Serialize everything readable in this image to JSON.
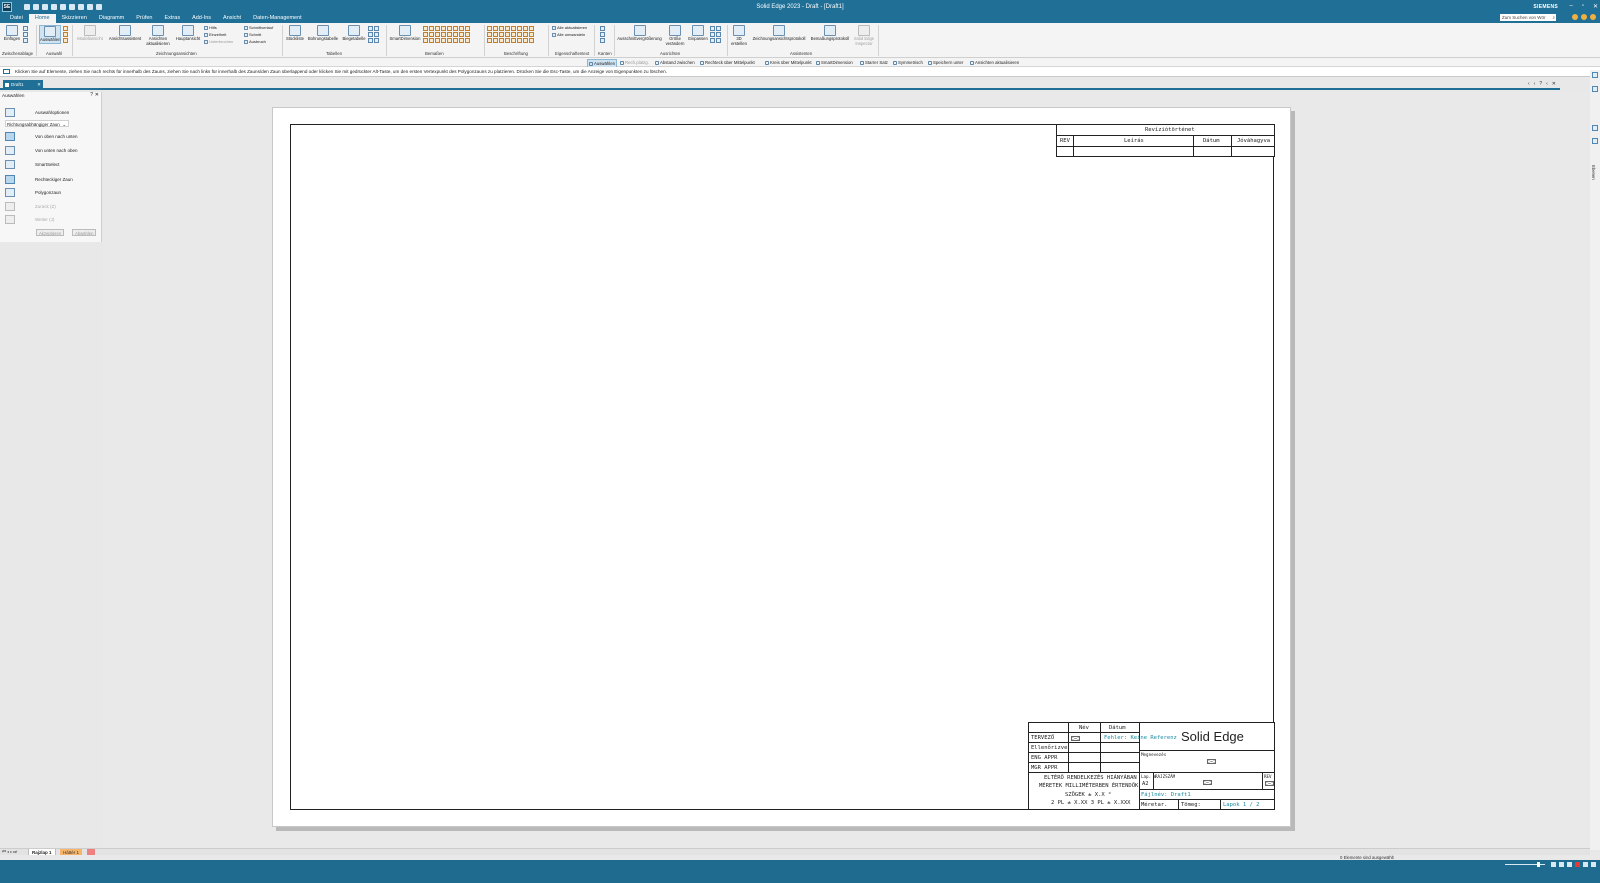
{
  "titlebar": {
    "title": "Solid Edge 2023 - Draft - [Draft1]",
    "brand": "SIEMENS",
    "min": "–",
    "restore": "▫",
    "close": "✕"
  },
  "menu": {
    "tabs": [
      "Datei",
      "Home",
      "Skizzieren",
      "Diagramm",
      "Prüfen",
      "Extras",
      "Add-Ins",
      "Ansicht",
      "Daten-Management"
    ],
    "active": "Home",
    "search_placeholder": "Zum Suchen von Wör",
    "search_icon": "⌕"
  },
  "ribbon": {
    "einfuegen": "Einfügen",
    "auswaehlen": "Auswählen",
    "modellansicht": "Modellansicht",
    "ansichtsassistent": "Ansichtsassistent",
    "ansichten_aktualisieren": "Ansichten aktualisieren",
    "hauptansicht": "Hauptansicht",
    "hilfs": "Hilfs",
    "einzelheit": "Einzelheit",
    "unterbrochen": "Unterbrochen",
    "schnittverlauf": "Schnittverlauf",
    "schnitt": "Schnitt",
    "ausbruch": "Ausbruch",
    "stueckliste": "Stückliste",
    "bohrungstabelle": "Bohrungstabelle",
    "biegetabelle": "Biegetabelle",
    "smartdimension": "SmartDimension",
    "alle_aktualisieren": "Alle aktualisieren",
    "alle_umwandeln": "Alle umwandeln",
    "ausschnittvergroesserung": "Ausschnittvergrößerung",
    "groesse_veraendern": "Größe verändern",
    "einpassen": "Einpassen",
    "erstellen_3d": "3D erstellen",
    "zeichnungsansichtsprotokoll": "Zeichnungsansichtsprotokoll",
    "bemassungsprotokoll": "Bemaßungsprotokoll",
    "solid_edge_inspector": "Solid Edge Inspector",
    "groups": {
      "zwischenablage": "Zwischenablage",
      "auswahl": "Auswahl",
      "zeichnungsansichten": "Zeichnungsansichten",
      "tabellen": "Tabellen",
      "bemassen": "Bemaßen",
      "beschriftung": "Beschriftung",
      "eigenschaftentext": "Eigenschaftentext",
      "kanten": "Kanten",
      "ausrichten": "Ausrichten",
      "assistenten": "Assistenten"
    }
  },
  "cmdbar": {
    "auswaehlen": "Auswählen",
    "rechpunkt": "Rech.platzg.",
    "abstand": "Abstand zwischen",
    "rechteck": "Rechteck über Mittelpunkt",
    "kreis": "Kreis über Mittelpunkt",
    "smartdimension": "SmartDimension",
    "starrer_satz": "Starrer Satz",
    "symmetrisch": "Symmetrisch",
    "speichern_unter": "Speichern unter",
    "ansichten_aktualisieren": "Ansichten aktualisieren"
  },
  "prompt": {
    "text": "Klicken Sie auf Elemente, ziehen Sie nach rechts für innerhalb des Zauns, ziehen Sie nach links für innerhalb des Zauns/den Zaun überlappend oder klicken Sie mit gedrückter Alt-Taste, um den ersten Vertexpunkt des Polygonzauns zu platzieren. Drücken Sie die Esc-Taste, um die Anzeige von Eigenpunkten zu löschen."
  },
  "doctab": {
    "label": "Draft1",
    "close": "✕",
    "nav": [
      "‹",
      "‹",
      "?",
      "‹",
      "✕"
    ]
  },
  "panel": {
    "title": "Auswählen",
    "help": "?",
    "close": "✕",
    "auswahloptionen": "Auswahloptionen",
    "zaun_mode": "Richtungsabhängiger Zaun",
    "chev": "⌄",
    "von_oben": "Von oben nach unten",
    "von_unten": "Von unten nach oben",
    "smartselect": "SmartSelect",
    "rechteckiger_zaun": "Rechteckiger Zaun",
    "polygonzaun": "Polygonzaun",
    "zurueck": "Zurück (Z)",
    "weiter": "Weiter (J)",
    "akzeptieren": "Akzeptieren",
    "abwaehlen": "Abwählen"
  },
  "rightstrip": {
    "label": "Ebenen"
  },
  "revision_table": {
    "title": "Revíziótörténet",
    "headers": [
      "REV",
      "Leírás",
      "Dátum",
      "Jóváhagyva"
    ]
  },
  "titleblock": {
    "hdr_nev": "Név",
    "hdr_datum": "Dátum",
    "tervezo": "TERVEZŐ",
    "ellenorizve": "Ellenőrizve",
    "eng_appr": "ENG APPR",
    "mgr_appr": "MGR APPR",
    "fehler": "Fehler: Keine Referenz",
    "company": "Solid Edge",
    "megnevezes": "Megnevezés",
    "lap_label": "Lap. m.",
    "rajzszam_label": "RAJZSZÁM",
    "lap_value": "A2",
    "rev_label": "REV",
    "fajlnev": "Fájlnév: Draft1",
    "meretar": "Méretar.",
    "tomeg": "Tömeg:",
    "lapok": "Lapok 1 / 2",
    "note1": "ELTÉRŐ RENDELKEZÉS HIÁNYÁBAN",
    "note2": "MÉRETEK MILLIMÉTERBEN ÉRTENDŐK",
    "note3": "SZÖGEK ± X.X °",
    "note4": "2 PL ± X.XX 3 PL ± X.XXX"
  },
  "sheettabs": {
    "nav": "⏮◂▸⏭",
    "active": "Rajzlap 1",
    "background": "Háttér 1",
    "new": ""
  },
  "status": {
    "selection": "0 Elemente sind ausgewählt"
  }
}
